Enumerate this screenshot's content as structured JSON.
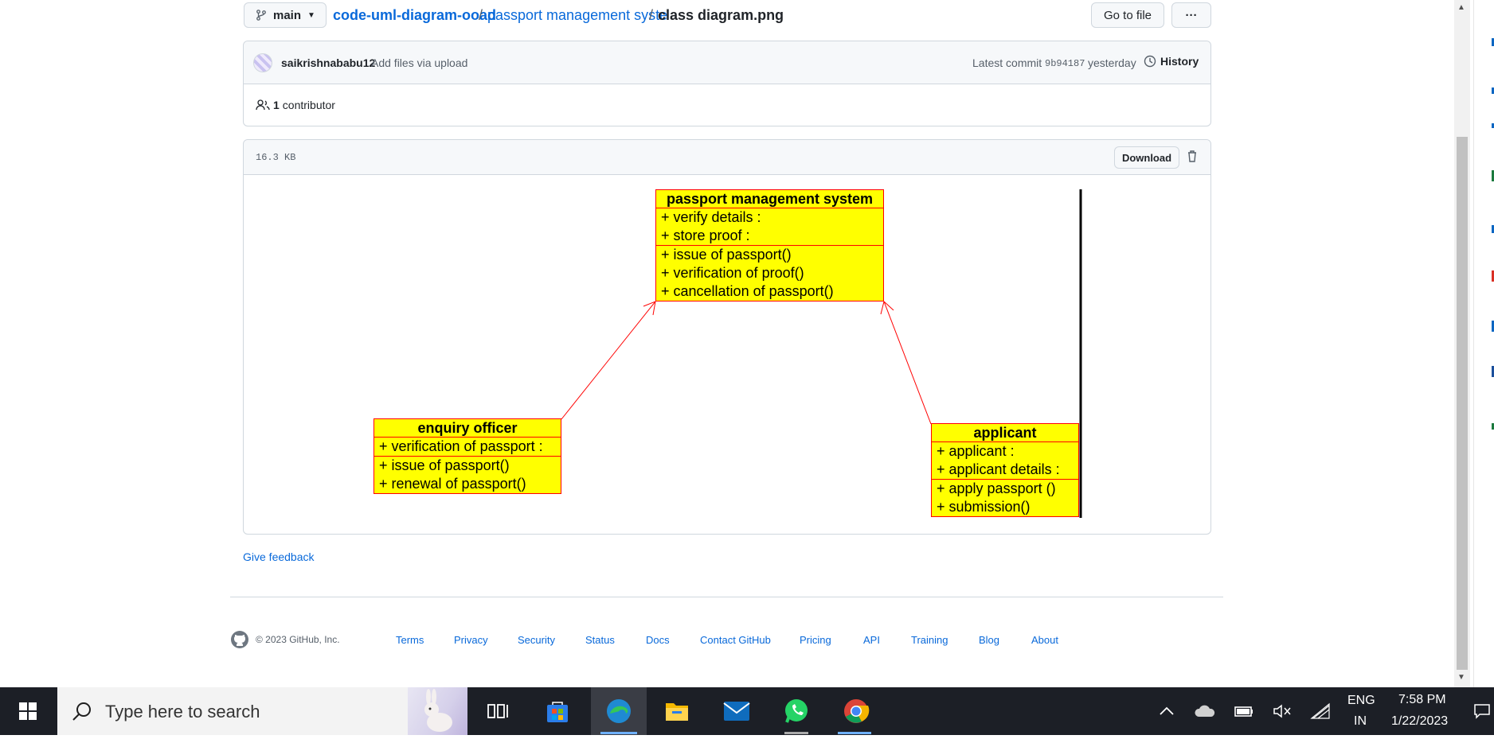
{
  "header": {
    "branch": "main",
    "breadcrumb": {
      "repo": "code-uml-diagram-ooad",
      "sep1": "/",
      "folder": "passport management syste",
      "sep2": "/",
      "file": "class diagram.png"
    },
    "go_to_file": "Go to file",
    "more": "···"
  },
  "commit": {
    "author": "saikrishnababu12",
    "message": "Add files via upload",
    "latest_label": "Latest commit",
    "hash": "9b94187",
    "when": "yesterday",
    "history": "History"
  },
  "contributors": {
    "count": "1",
    "label": "contributor"
  },
  "file": {
    "size": "16.3 KB",
    "download": "Download"
  },
  "diagram": {
    "classes": [
      {
        "name": "passport management system",
        "attributes": [
          "+ verify details :",
          "+ store proof :"
        ],
        "operations": [
          "+ issue of passport()",
          "+ verification of proof()",
          "+ cancellation of passport()"
        ]
      },
      {
        "name": "enquiry officer",
        "attributes": [
          "+ verification of passport :"
        ],
        "operations": [
          "+ issue of passport()",
          "+ renewal of passport()"
        ]
      },
      {
        "name": "applicant",
        "attributes": [
          "+ applicant :",
          "+ applicant details :"
        ],
        "operations": [
          "+ apply passport ()",
          "+ submission()"
        ]
      }
    ],
    "colors": {
      "fill": "#ffff00",
      "border": "#ff0000"
    }
  },
  "feedback": "Give feedback",
  "footer": {
    "copyright": "© 2023 GitHub, Inc.",
    "links": [
      "Terms",
      "Privacy",
      "Security",
      "Status",
      "Docs",
      "Contact GitHub",
      "Pricing",
      "API",
      "Training",
      "Blog",
      "About"
    ]
  },
  "taskbar": {
    "search_placeholder": "Type here to search",
    "lang_top": "ENG",
    "lang_bottom": "IN",
    "time": "7:58 PM",
    "date": "1/22/2023",
    "icons": [
      "windows-start-icon",
      "search-icon",
      "task-view-icon",
      "store-icon",
      "edge-icon",
      "file-explorer-icon",
      "mail-icon",
      "whatsapp-icon",
      "chrome-icon"
    ]
  }
}
